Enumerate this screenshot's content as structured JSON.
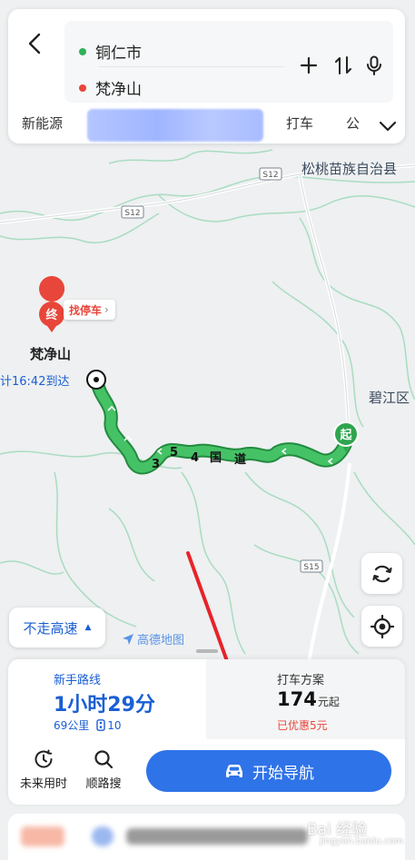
{
  "route": {
    "start": "铜仁市",
    "end": "梵净山",
    "start_color": "#2fb15a",
    "end_color": "#e8463a"
  },
  "mode_tabs": [
    "新能源",
    "打车",
    "公"
  ],
  "map": {
    "place_county": "松桃苗族自治县",
    "place_district": "碧江区",
    "place_destination": "梵净山",
    "road_s12_a": "S12",
    "road_s12_b": "S12",
    "road_s15": "S15",
    "route_road_chars": [
      "3",
      "5",
      "4",
      "国",
      "道"
    ],
    "eta_text": "计16:42到达",
    "end_marker": "终",
    "parking_label": "找停车",
    "start_marker": "起",
    "route_color": "#34b254"
  },
  "controls": {
    "avoid_highway": "不走高速",
    "logo_text": "高德地图"
  },
  "route_options": [
    {
      "tag": "新手路线",
      "time": "1小时29分",
      "distance": "69公里",
      "traffic_lights": "10"
    }
  ],
  "taxi": {
    "title": "打车方案",
    "price": "174",
    "price_unit": "元起",
    "discount": "已优惠5元"
  },
  "tools": {
    "future": "未来用时",
    "along": "顺路搜"
  },
  "nav_button": "开始导航",
  "watermark": {
    "main": "Bai 经验",
    "sub": "jingyan.baidu.com"
  },
  "annotation_color": "#e8232a",
  "accent_color": "#2f73e8"
}
